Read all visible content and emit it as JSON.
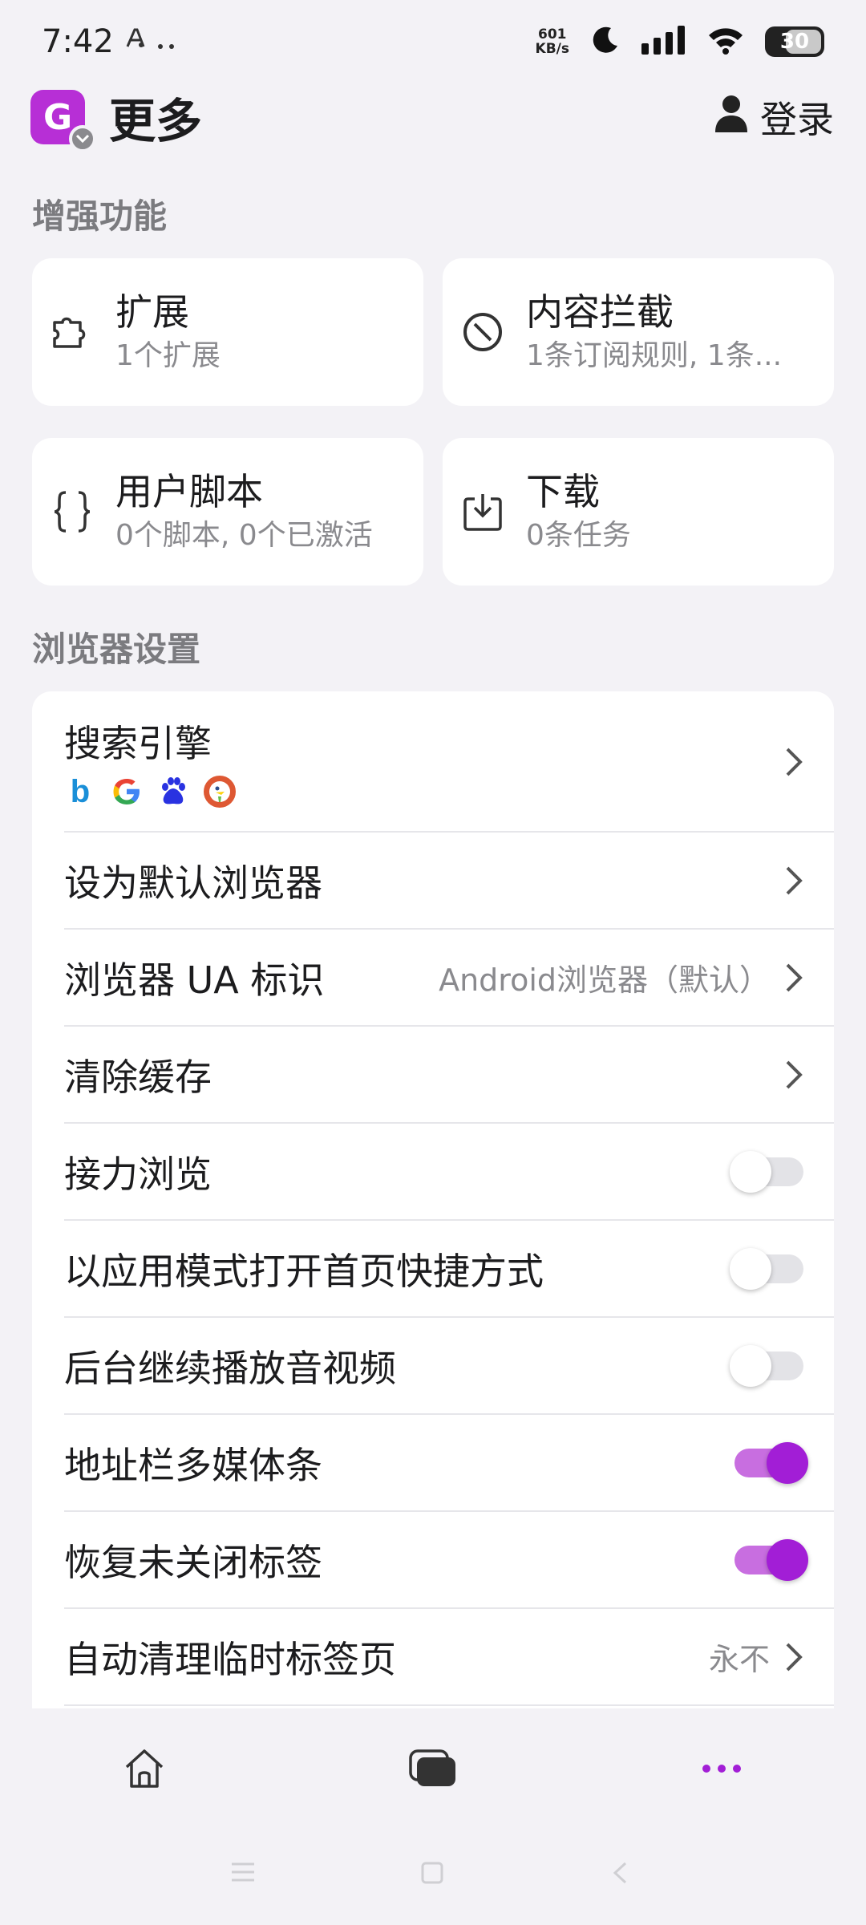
{
  "status_bar": {
    "time": "7:42",
    "net_speed_value": "601",
    "net_speed_unit": "KB/s",
    "battery": "30"
  },
  "header": {
    "avatar_letter": "G",
    "title": "更多",
    "login_label": "登录"
  },
  "sections": {
    "enhanced": "增强功能",
    "browser_settings": "浏览器设置"
  },
  "cards": [
    {
      "title": "扩展",
      "subtitle": "1个扩展",
      "icon": "extension-icon"
    },
    {
      "title": "内容拦截",
      "subtitle": "1条订阅规则, 1条...",
      "icon": "block-icon"
    },
    {
      "title": "用户脚本",
      "subtitle": "0个脚本, 0个已激活",
      "icon": "braces-icon"
    },
    {
      "title": "下载",
      "subtitle": "0条任务",
      "icon": "download-icon"
    }
  ],
  "settings": {
    "search_engine": "搜索引擎",
    "search_engines_shown": [
      "Bing",
      "Google",
      "Baidu",
      "DuckDuckGo"
    ],
    "default_browser": "设为默认浏览器",
    "ua": "浏览器 UA 标识",
    "ua_value": "Android浏览器（默认）",
    "clear_cache": "清除缓存",
    "relay_browsing": "接力浏览",
    "relay_browsing_on": false,
    "app_mode_shortcut": "以应用模式打开首页快捷方式",
    "app_mode_shortcut_on": false,
    "background_play": "后台继续播放音视频",
    "background_play_on": false,
    "media_bar": "地址栏多媒体条",
    "media_bar_on": true,
    "restore_tabs": "恢复未关闭标签",
    "restore_tabs_on": true,
    "auto_clean_temp_tabs": "自动清理临时标签页",
    "auto_clean_value": "永不"
  },
  "colors": {
    "accent": "#a21ed6",
    "avatar": "#b72fd6",
    "background": "#f3f2f6"
  }
}
